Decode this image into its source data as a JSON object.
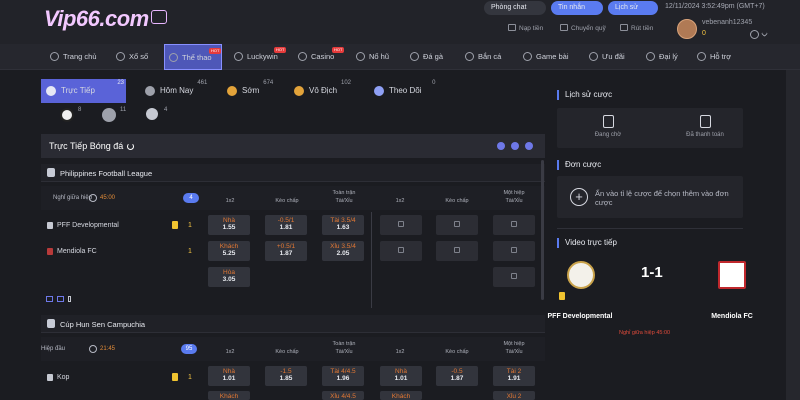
{
  "header": {
    "logo_text": "Vip66.com",
    "chat_label": "Phòng chat",
    "messages_label": "Tin nhắn",
    "history_label": "Lịch sử",
    "datetime": "12/11/2024 3:52:49pm   (GMT+7)",
    "deposit_label": "Nạp tiền",
    "transfer_label": "Chuyển quỹ",
    "withdraw_label": "Rút tiền",
    "username": "vebenanh12345",
    "balance": "0"
  },
  "nav": {
    "items": [
      {
        "label": "Trang chủ",
        "hot": ""
      },
      {
        "label": "Xổ số",
        "hot": ""
      },
      {
        "label": "Thể thao",
        "hot": "HOT"
      },
      {
        "label": "Luckywin",
        "hot": "HOT"
      },
      {
        "label": "Casino",
        "hot": "HOT"
      },
      {
        "label": "Nổ hũ",
        "hot": ""
      },
      {
        "label": "Đá gà",
        "hot": ""
      },
      {
        "label": "Bắn cá",
        "hot": ""
      },
      {
        "label": "Game bài",
        "hot": ""
      },
      {
        "label": "Ưu đãi",
        "hot": ""
      },
      {
        "label": "Đại lý",
        "hot": ""
      },
      {
        "label": "Hỗ trợ",
        "hot": ""
      }
    ]
  },
  "tabs": [
    {
      "label": "Trực Tiếp",
      "count": "23"
    },
    {
      "label": "Hôm Nay",
      "count": "461"
    },
    {
      "label": "Sớm",
      "count": "674"
    },
    {
      "label": "Vô Địch",
      "count": "102"
    },
    {
      "label": "Theo Dõi",
      "count": "0"
    }
  ],
  "sports": [
    {
      "icon": "soccer-ball-icon",
      "count": "8"
    },
    {
      "icon": "basketball-icon",
      "count": "11"
    },
    {
      "icon": "table-tennis-icon",
      "count": "4"
    }
  ],
  "panel": {
    "title": "Trực Tiếp Bóng đá"
  },
  "columns": {
    "c1": "1x2",
    "c2": "Kèo chấp",
    "c3_line1": "Toàn trận",
    "c3_line2": "Tài/Xỉu",
    "c4": "1x2",
    "c5": "Kèo chấp",
    "c6_line1": "Một hiệp",
    "c6_line2": "Tài/Xỉu"
  },
  "leagues": [
    {
      "name": "Philippines Football League",
      "status": "Nghỉ giữa hiệp",
      "time": "45:00",
      "markets": "4",
      "teams": [
        {
          "name": "PFF Developmental",
          "card": "1",
          "score": "1"
        },
        {
          "name": "Mendiola FC",
          "card": "",
          "score": "1"
        }
      ],
      "odds": {
        "home_1x2": {
          "top": "Nhà",
          "bot": "1.55"
        },
        "home_hdp": {
          "top": "-0.5/1",
          "bot": "1.81"
        },
        "home_ou": {
          "top": "Tài 3.5/4",
          "bot": "1.63"
        },
        "away_1x2": {
          "top": "Khách",
          "bot": "5.25"
        },
        "away_hdp": {
          "top": "+0.5/1",
          "bot": "1.87"
        },
        "away_ou": {
          "top": "Xỉu 3.5/4",
          "bot": "2.05"
        },
        "draw_1x2": {
          "top": "Hòa",
          "bot": "3.05"
        }
      }
    },
    {
      "name": "Cúp Hun Sen Campuchia",
      "status": "Hiệp đầu",
      "time": "21:45",
      "markets": "95",
      "teams": [
        {
          "name": "Kop",
          "card": "1",
          "score": "1"
        },
        {
          "name": "",
          "card": "",
          "score": ""
        }
      ],
      "odds": {
        "home_1x2": {
          "top": "Nhà",
          "bot": "1.01"
        },
        "home_hdp": {
          "top": "-1.5",
          "bot": "1.85"
        },
        "home_ou": {
          "top": "Tài 4/4.5",
          "bot": "1.96"
        },
        "h1_1x2": {
          "top": "Nhà",
          "bot": "1.01"
        },
        "h1_hdp": {
          "top": "-0.5",
          "bot": "1.87"
        },
        "h1_ou": {
          "top": "Tài 2",
          "bot": "1.91"
        },
        "away_1x2_top": "Khách",
        "away_ou_top": "Xỉu 4/4.5",
        "away_h1_1x2_top": "Khách",
        "away_h1_ou_top": "Xỉu 2"
      }
    }
  ],
  "right": {
    "history_title": "Lịch sử cược",
    "pending_label": "Đang chờ",
    "settled_label": "Đã thanh toán",
    "slip_title": "Đơn cược",
    "slip_hint": "Ấn vào tỉ lệ cược để chọn thêm vào đơn cược",
    "video_title": "Video trực tiếp",
    "home_team": "PFF Developmental",
    "away_team": "Mendiola FC",
    "score": "1-1",
    "match_status": "Nghỉ giữa hiệp   45:00",
    "home_card": "1"
  },
  "colors": {
    "accent": "#5a63d8",
    "odds_label": "#e37834",
    "score_yellow": "#f5c542",
    "live_red": "#e04b3b"
  }
}
